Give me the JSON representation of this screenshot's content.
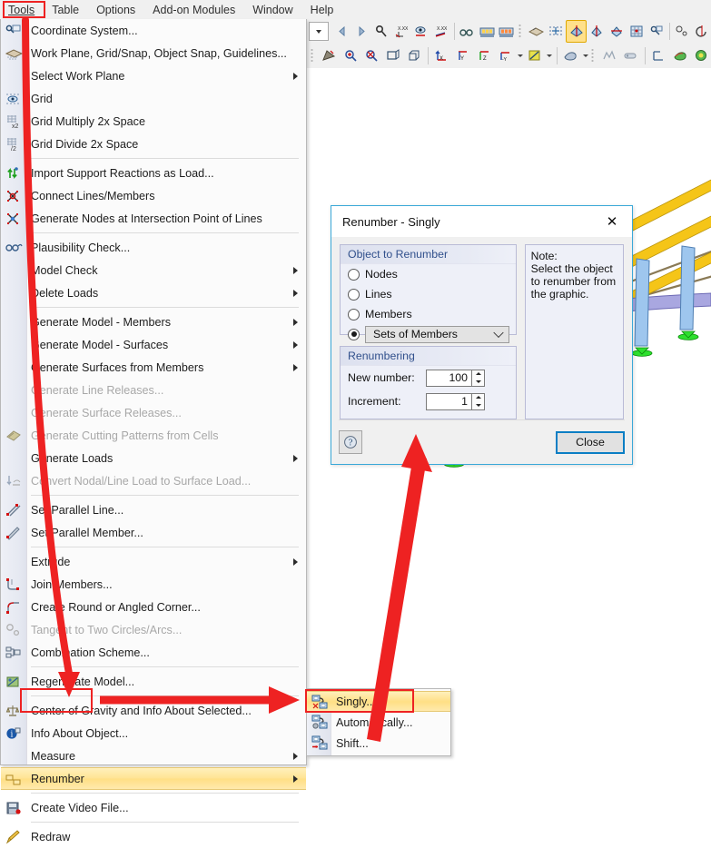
{
  "app": {
    "menubar": [
      {
        "label": "Tools",
        "accel": "T",
        "highlighted": true,
        "name": "menubar-tools"
      },
      {
        "label": "Table",
        "accel": "a",
        "highlighted": false,
        "name": "menubar-table"
      },
      {
        "label": "Options",
        "accel": "O",
        "highlighted": false,
        "name": "menubar-options"
      },
      {
        "label": "Add-on Modules",
        "accel": "A",
        "highlighted": false,
        "name": "menubar-addon-modules"
      },
      {
        "label": "Window",
        "accel": "W",
        "highlighted": false,
        "name": "menubar-window"
      },
      {
        "label": "Help",
        "accel": "H",
        "highlighted": false,
        "name": "menubar-help"
      }
    ]
  },
  "tools_menu": {
    "items": [
      {
        "label": "Coordinate System...",
        "icon": "coordinate-system-icon",
        "submenu": false,
        "disabled": false,
        "sep_after": false
      },
      {
        "label": "Work Plane, Grid/Snap, Object Snap, Guidelines...",
        "icon": "work-plane-icon",
        "submenu": false,
        "disabled": false,
        "sep_after": false
      },
      {
        "label": "Select Work Plane",
        "icon": "",
        "submenu": true,
        "disabled": false,
        "sep_after": false
      },
      {
        "label": "Grid",
        "icon": "grid-icon",
        "submenu": false,
        "disabled": false,
        "sep_after": false
      },
      {
        "label": "Grid Multiply 2x Space",
        "icon": "grid-multiply-icon",
        "submenu": false,
        "disabled": false,
        "sep_after": false
      },
      {
        "label": "Grid Divide 2x Space",
        "icon": "grid-divide-icon",
        "submenu": false,
        "disabled": false,
        "sep_after": true
      },
      {
        "label": "Import Support Reactions as Load...",
        "icon": "import-reactions-icon",
        "submenu": false,
        "disabled": false,
        "sep_after": false
      },
      {
        "label": "Connect Lines/Members",
        "icon": "connect-lines-icon",
        "submenu": false,
        "disabled": false,
        "sep_after": false
      },
      {
        "label": "Generate Nodes at Intersection Point of Lines",
        "icon": "intersection-nodes-icon",
        "submenu": false,
        "disabled": false,
        "sep_after": true
      },
      {
        "label": "Plausibility Check...",
        "icon": "plausibility-check-icon",
        "submenu": false,
        "disabled": false,
        "sep_after": false
      },
      {
        "label": "Model Check",
        "icon": "",
        "submenu": true,
        "disabled": false,
        "sep_after": false
      },
      {
        "label": "Delete Loads",
        "icon": "",
        "submenu": true,
        "disabled": false,
        "sep_after": true
      },
      {
        "label": "Generate Model - Members",
        "icon": "",
        "submenu": true,
        "disabled": false,
        "sep_after": false
      },
      {
        "label": "Generate Model - Surfaces",
        "icon": "",
        "submenu": true,
        "disabled": false,
        "sep_after": false
      },
      {
        "label": "Generate Surfaces from Members",
        "icon": "",
        "submenu": true,
        "disabled": false,
        "sep_after": false
      },
      {
        "label": "Generate Line Releases...",
        "icon": "",
        "submenu": false,
        "disabled": true,
        "sep_after": false
      },
      {
        "label": "Generate Surface Releases...",
        "icon": "",
        "submenu": false,
        "disabled": true,
        "sep_after": false
      },
      {
        "label": "Generate Cutting Patterns from Cells",
        "icon": "cutting-pattern-icon",
        "submenu": false,
        "disabled": true,
        "sep_after": false
      },
      {
        "label": "Generate Loads",
        "icon": "",
        "submenu": true,
        "disabled": false,
        "sep_after": false
      },
      {
        "label": "Convert Nodal/Line Load to Surface Load...",
        "icon": "convert-load-icon",
        "submenu": false,
        "disabled": true,
        "sep_after": true
      },
      {
        "label": "Set Parallel Line...",
        "icon": "set-parallel-line-icon",
        "submenu": false,
        "disabled": false,
        "sep_after": false
      },
      {
        "label": "Set Parallel Member...",
        "icon": "set-parallel-member-icon",
        "submenu": false,
        "disabled": false,
        "sep_after": true
      },
      {
        "label": "Extrude",
        "icon": "",
        "submenu": true,
        "disabled": false,
        "sep_after": false
      },
      {
        "label": "Join Members...",
        "icon": "join-members-icon",
        "submenu": false,
        "disabled": false,
        "sep_after": false
      },
      {
        "label": "Create Round or Angled Corner...",
        "icon": "round-corner-icon",
        "submenu": false,
        "disabled": false,
        "sep_after": false
      },
      {
        "label": "Tangent to Two Circles/Arcs...",
        "icon": "tangent-icon",
        "submenu": false,
        "disabled": true,
        "sep_after": false
      },
      {
        "label": "Combination Scheme...",
        "icon": "combination-scheme-icon",
        "submenu": false,
        "disabled": false,
        "sep_after": true
      },
      {
        "label": "Regenerate Model...",
        "icon": "regenerate-model-icon",
        "submenu": false,
        "disabled": false,
        "sep_after": true
      },
      {
        "label": "Center of Gravity and Info About Selected...",
        "icon": "center-of-gravity-icon",
        "submenu": false,
        "disabled": false,
        "sep_after": false
      },
      {
        "label": "Info About Object...",
        "icon": "info-icon",
        "submenu": false,
        "disabled": false,
        "sep_after": false
      },
      {
        "label": "Measure",
        "icon": "",
        "submenu": true,
        "disabled": false,
        "sep_after": false
      },
      {
        "label": "Renumber",
        "icon": "renumber-icon",
        "submenu": true,
        "disabled": false,
        "sep_after": true,
        "highlighted": true
      },
      {
        "label": "Create Video File...",
        "icon": "create-video-icon",
        "submenu": false,
        "disabled": false,
        "sep_after": true
      },
      {
        "label": "Redraw",
        "icon": "redraw-icon",
        "submenu": false,
        "disabled": false,
        "sep_after": false
      }
    ]
  },
  "renumber_submenu": {
    "items": [
      {
        "label": "Singly...",
        "icon": "renumber-singly-icon",
        "highlighted": true
      },
      {
        "label": "Automatically...",
        "icon": "renumber-automatically-icon",
        "highlighted": false
      },
      {
        "label": "Shift...",
        "icon": "renumber-shift-icon",
        "highlighted": false
      }
    ]
  },
  "dialog": {
    "title": "Renumber - Singly",
    "close_icon": "close-icon",
    "object_group": {
      "caption": "Object to Renumber",
      "options": [
        {
          "label": "Nodes",
          "selected": false
        },
        {
          "label": "Lines",
          "selected": false
        },
        {
          "label": "Members",
          "selected": false
        }
      ],
      "combo_selected": true,
      "combo_value": "Sets of Members"
    },
    "renumbering_group": {
      "caption": "Renumbering",
      "fields": [
        {
          "label": "New number:",
          "value": "100"
        },
        {
          "label": "Increment:",
          "value": "1"
        }
      ]
    },
    "note": {
      "heading": "Note:",
      "text": "Select the object to renumber from the graphic."
    },
    "help_icon": "help-icon",
    "close_button": "Close"
  },
  "annotations": {
    "accent_color": "#ee2222",
    "highlight_color": "#ffdf85",
    "focus_border": "#0b7ec4"
  },
  "toolbar": {
    "row1": [
      "dropdown-small",
      "back-arrow-icon",
      "forward-arrow-icon",
      "zoom-pan-icon",
      "dim-xx-icon",
      "view-eye-icon",
      "dim-xx-2-icon",
      "glasses-icon",
      "render-table-icon",
      "render-table-2-icon",
      "work-plane-tb-icon",
      "snap-grid-icon",
      "selected-object-icon",
      "object-xy-icon",
      "object-xz-icon",
      "grid-points-icon",
      "coord-system-tb-icon",
      "tangent-tb-icon",
      "rotate-tb-icon"
    ],
    "row2": [
      "mouse-select-icon",
      "zoom-in-icon",
      "zoom-out-icon",
      "zoom-box-icon",
      "zoom-3d-icon",
      "axis-x-icon",
      "axis-y-icon",
      "axis-z-icon",
      "axis-ny-icon",
      "render-mode-icon",
      "shading-icon",
      "wire-icon",
      "connect-icon",
      "axes-icon",
      "results-icon",
      "solid-results-icon"
    ]
  }
}
